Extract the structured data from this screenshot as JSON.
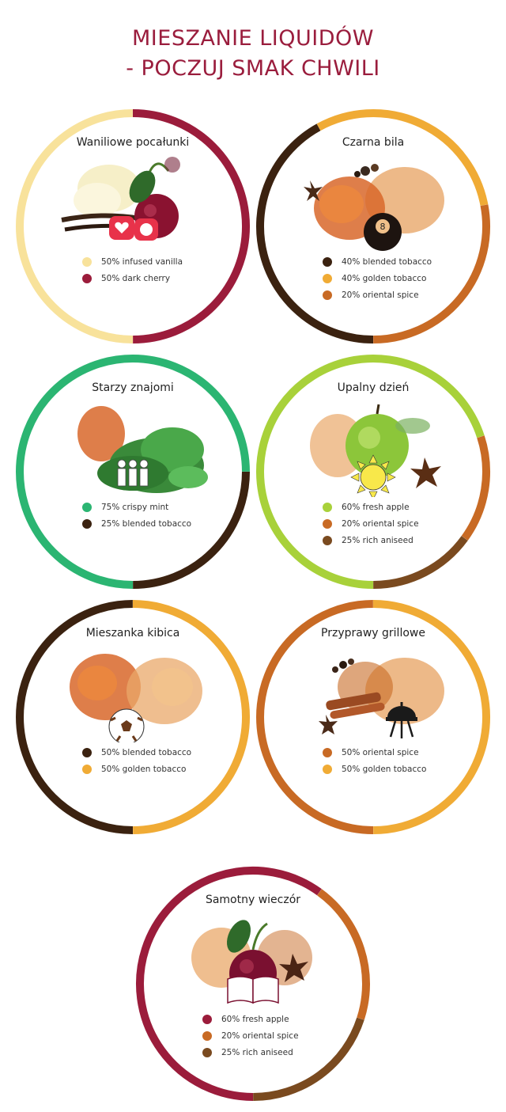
{
  "page": {
    "title_line1": "MIESZANIE LIQUIDÓW",
    "title_line2": "- POCZUJ SMAK CHWILI"
  },
  "cards": [
    {
      "name": "Waniliowe pocałunki",
      "icon": "hearts-icon",
      "ingredients": [
        {
          "label": "50% infused vanilla",
          "color": "#f8e29b"
        },
        {
          "label": "50% dark cherry",
          "color": "#9b1c3b"
        }
      ]
    },
    {
      "name": "Czarna bila",
      "icon": "eight-ball-icon",
      "ingredients": [
        {
          "label": "40% blended tobacco",
          "color": "#3b2210"
        },
        {
          "label": "40% golden tobacco",
          "color": "#f0ab35"
        },
        {
          "label": "20% oriental spice",
          "color": "#c86a24"
        }
      ]
    },
    {
      "name": "Starzy znajomi",
      "icon": "friends-icon",
      "ingredients": [
        {
          "label": "75% crispy mint",
          "color": "#2bb572"
        },
        {
          "label": "25% blended tobacco",
          "color": "#3b2210"
        }
      ]
    },
    {
      "name": "Upalny dzień",
      "icon": "sun-icon",
      "ingredients": [
        {
          "label": "60% fresh apple",
          "color": "#a8d13a"
        },
        {
          "label": "20% oriental spice",
          "color": "#c86a24"
        },
        {
          "label": "25% rich aniseed",
          "color": "#7a4a1f"
        }
      ]
    },
    {
      "name": "Mieszanka kibica",
      "icon": "soccer-ball-icon",
      "ingredients": [
        {
          "label": "50% blended tobacco",
          "color": "#3b2210"
        },
        {
          "label": "50% golden tobacco",
          "color": "#f0ab35"
        }
      ]
    },
    {
      "name": "Przyprawy grillowe",
      "icon": "grill-icon",
      "ingredients": [
        {
          "label": "50% oriental spice",
          "color": "#c86a24"
        },
        {
          "label": "50% golden tobacco",
          "color": "#f0ab35"
        }
      ]
    },
    {
      "name": "Samotny wieczór",
      "icon": "book-icon",
      "ingredients": [
        {
          "label": "60% fresh apple",
          "color": "#9b1c3b"
        },
        {
          "label": "20% oriental spice",
          "color": "#c86a24"
        },
        {
          "label": "25% rich aniseed",
          "color": "#7a4a1f"
        }
      ]
    }
  ]
}
